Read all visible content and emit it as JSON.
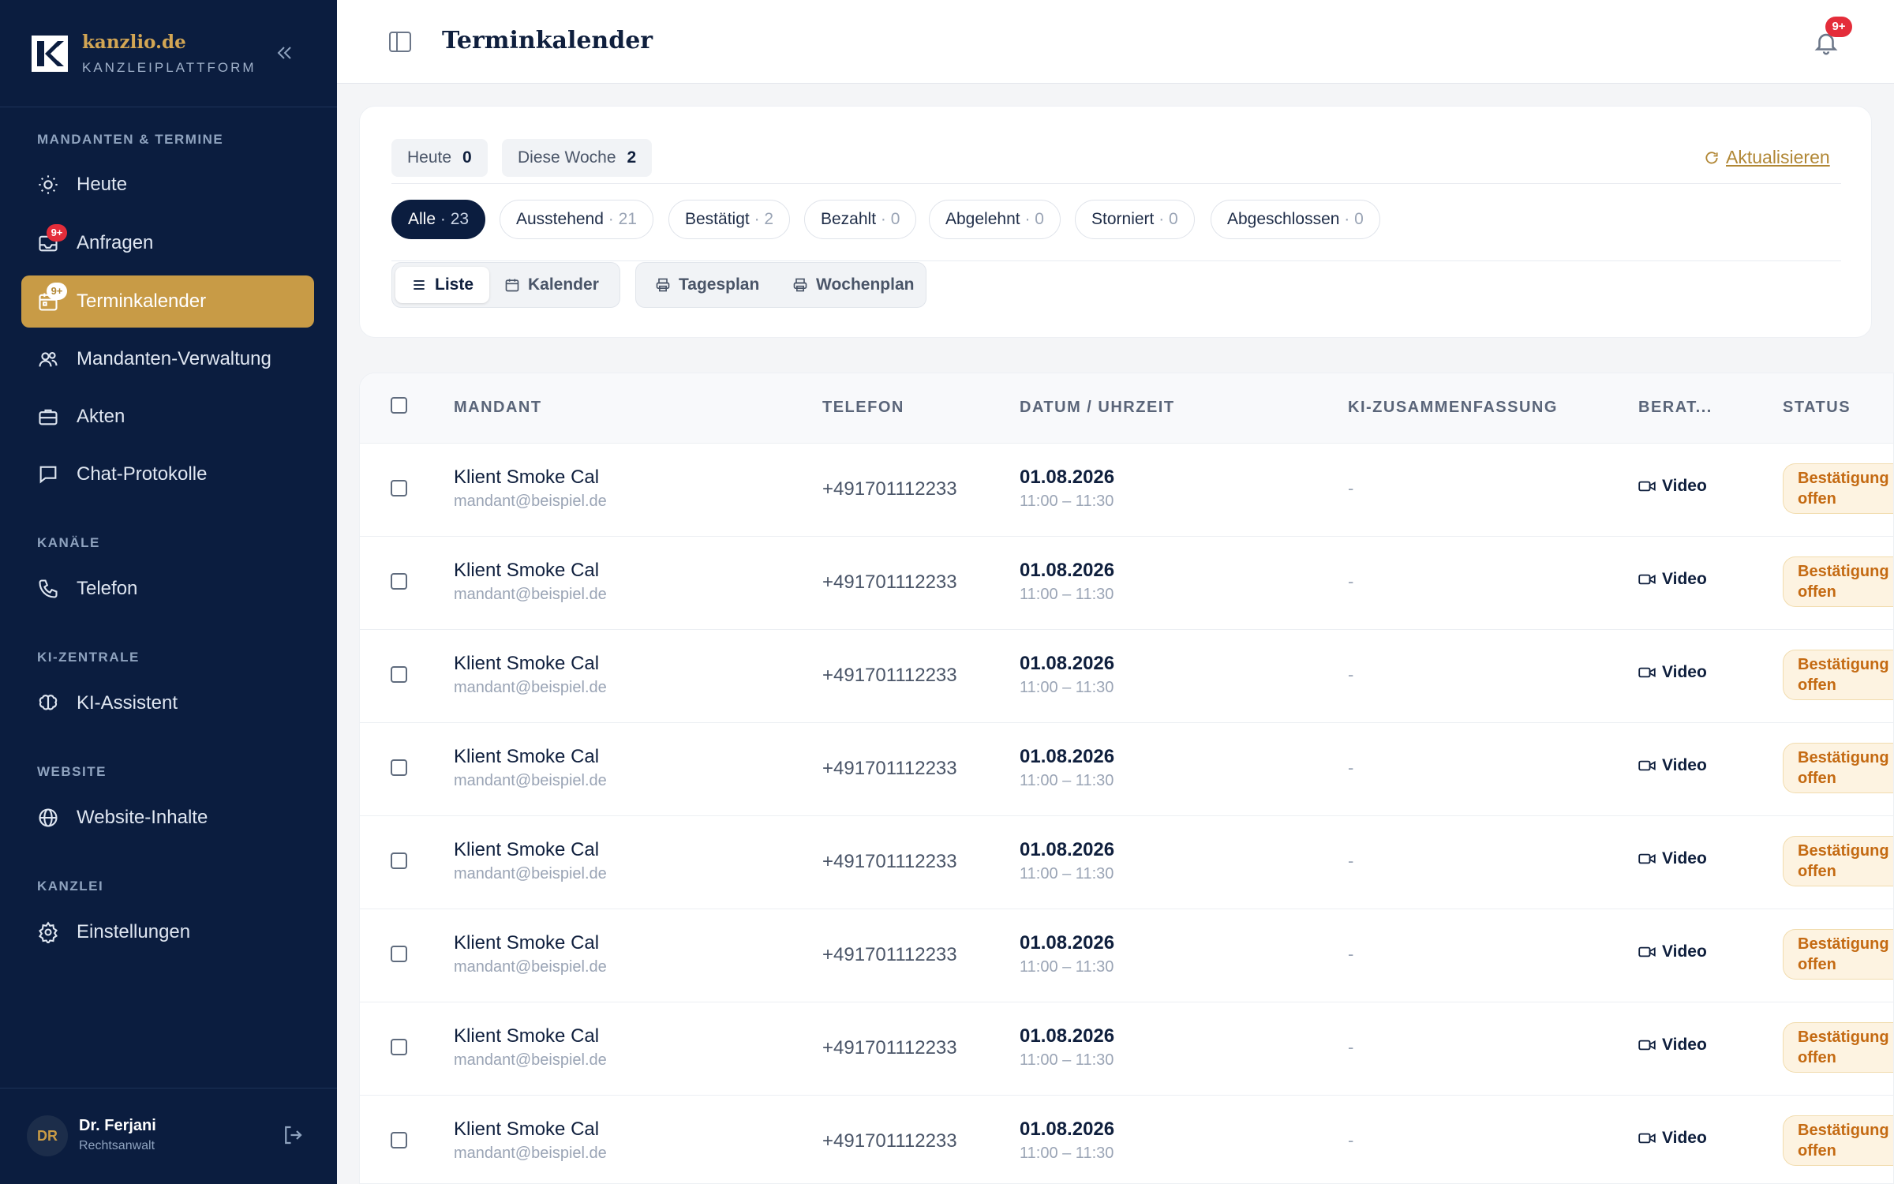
{
  "brand": {
    "name": "kanzlio.de",
    "subtitle": "KANZLEIPLATTFORM"
  },
  "sidebar": {
    "sections": [
      "MANDANTEN & TERMINE",
      "KANÄLE",
      "KI-ZENTRALE",
      "WEBSITE",
      "KANZLEI"
    ],
    "items": [
      {
        "label": "Heute",
        "icon": "sun-icon"
      },
      {
        "label": "Anfragen",
        "icon": "inbox-icon",
        "badge": "9+"
      },
      {
        "label": "Terminkalender",
        "icon": "calendar-icon",
        "badge": "9+",
        "active": true
      },
      {
        "label": "Mandanten-Verwaltung",
        "icon": "users-icon"
      },
      {
        "label": "Akten",
        "icon": "briefcase-icon"
      },
      {
        "label": "Chat-Protokolle",
        "icon": "chat-icon"
      },
      {
        "label": "Telefon",
        "icon": "phone-icon"
      },
      {
        "label": "KI-Assistent",
        "icon": "brain-icon"
      },
      {
        "label": "Website-Inhalte",
        "icon": "globe-icon"
      },
      {
        "label": "Einstellungen",
        "icon": "gear-icon"
      }
    ]
  },
  "user": {
    "initials": "DR",
    "name": "Dr. Ferjani",
    "role": "Rechtsanwalt"
  },
  "header": {
    "title": "Terminkalender",
    "notification_count": "9+"
  },
  "counters": [
    {
      "label": "Heute",
      "value": "0"
    },
    {
      "label": "Diese Woche",
      "value": "2"
    }
  ],
  "refresh_label": "Aktualisieren",
  "filters": [
    {
      "label": "Alle",
      "count": "· 23",
      "active": true
    },
    {
      "label": "Ausstehend",
      "count": "· 21"
    },
    {
      "label": "Bestätigt",
      "count": "· 2"
    },
    {
      "label": "Bezahlt",
      "count": "· 0"
    },
    {
      "label": "Abgelehnt",
      "count": "· 0"
    },
    {
      "label": "Storniert",
      "count": "· 0"
    },
    {
      "label": "Abgeschlossen",
      "count": "· 0"
    }
  ],
  "views": {
    "list": "Liste",
    "calendar": "Kalender"
  },
  "prints": {
    "day": "Tagesplan",
    "week": "Wochenplan"
  },
  "table": {
    "columns": [
      "MANDANT",
      "TELEFON",
      "DATUM / UHRZEIT",
      "KI-ZUSAMMENFASSUNG",
      "BERAT...",
      "STATUS"
    ],
    "rows": [
      {
        "name": "Klient Smoke Cal",
        "email": "mandant@beispiel.de",
        "phone": "+491701112233",
        "date": "01.08.2026",
        "time": "11:00 – 11:30",
        "summary": "-",
        "type": "Video",
        "status_line1": "Bestätigung",
        "status_line2": "offen"
      },
      {
        "name": "Klient Smoke Cal",
        "email": "mandant@beispiel.de",
        "phone": "+491701112233",
        "date": "01.08.2026",
        "time": "11:00 – 11:30",
        "summary": "-",
        "type": "Video",
        "status_line1": "Bestätigung",
        "status_line2": "offen"
      },
      {
        "name": "Klient Smoke Cal",
        "email": "mandant@beispiel.de",
        "phone": "+491701112233",
        "date": "01.08.2026",
        "time": "11:00 – 11:30",
        "summary": "-",
        "type": "Video",
        "status_line1": "Bestätigung",
        "status_line2": "offen"
      },
      {
        "name": "Klient Smoke Cal",
        "email": "mandant@beispiel.de",
        "phone": "+491701112233",
        "date": "01.08.2026",
        "time": "11:00 – 11:30",
        "summary": "-",
        "type": "Video",
        "status_line1": "Bestätigung",
        "status_line2": "offen"
      },
      {
        "name": "Klient Smoke Cal",
        "email": "mandant@beispiel.de",
        "phone": "+491701112233",
        "date": "01.08.2026",
        "time": "11:00 – 11:30",
        "summary": "-",
        "type": "Video",
        "status_line1": "Bestätigung",
        "status_line2": "offen"
      },
      {
        "name": "Klient Smoke Cal",
        "email": "mandant@beispiel.de",
        "phone": "+491701112233",
        "date": "01.08.2026",
        "time": "11:00 – 11:30",
        "summary": "-",
        "type": "Video",
        "status_line1": "Bestätigung",
        "status_line2": "offen"
      },
      {
        "name": "Klient Smoke Cal",
        "email": "mandant@beispiel.de",
        "phone": "+491701112233",
        "date": "01.08.2026",
        "time": "11:00 – 11:30",
        "summary": "-",
        "type": "Video",
        "status_line1": "Bestätigung",
        "status_line2": "offen"
      },
      {
        "name": "Klient Smoke Cal",
        "email": "mandant@beispiel.de",
        "phone": "+491701112233",
        "date": "01.08.2026",
        "time": "11:00 – 11:30",
        "summary": "-",
        "type": "Video",
        "status_line1": "Bestätigung",
        "status_line2": "offen"
      }
    ]
  },
  "colors": {
    "sidebar_bg": "#0b1d3f",
    "accent_gold": "#c89b46",
    "badge_red": "#e42d3a",
    "status_orange": "#c46a12"
  }
}
